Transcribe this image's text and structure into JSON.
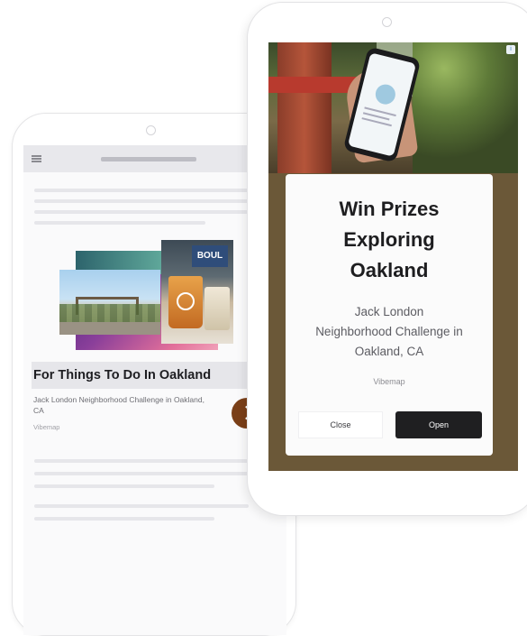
{
  "back_phone": {
    "ad": {
      "title": "For Things To Do In Oakland",
      "description": "Jack London Neighborhood Challenge in Oakland, CA",
      "source": "Vibemap",
      "photo_sign_text": "BOUL"
    }
  },
  "front_phone": {
    "ad_choices_mark": "i",
    "card": {
      "title": "Win Prizes\nExploring\nOakland",
      "subtitle": "Jack London\nNeighborhood Challenge in\nOakland, CA",
      "brand": "Vibemap",
      "close_label": "Close",
      "open_label": "Open"
    }
  },
  "colors": {
    "arrow_button": "#7a3f18",
    "open_button": "#1f1f21",
    "card_background": "#fbfbfb"
  },
  "icons": [
    "hamburger-icon",
    "chevron-right-icon",
    "ad-choices-icon"
  ]
}
